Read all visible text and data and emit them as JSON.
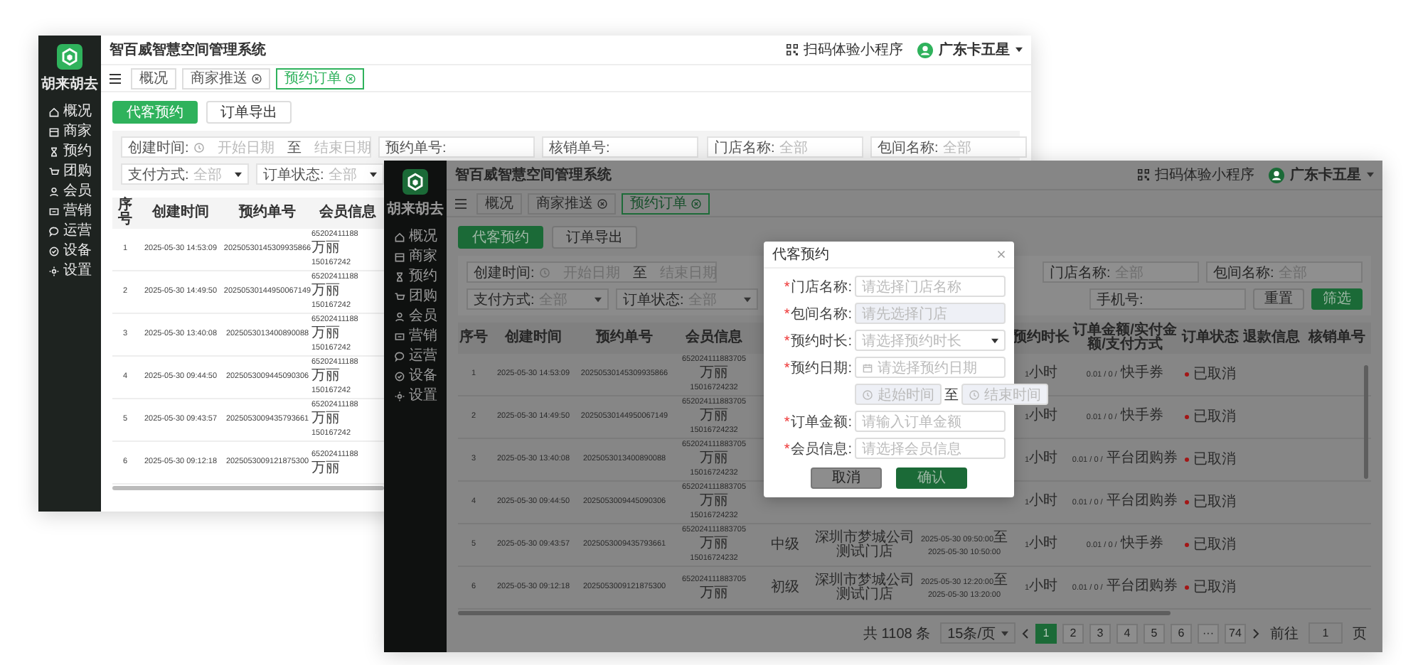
{
  "back_window": {
    "brand": "胡来胡去",
    "title": "智百威智慧空间管理系统",
    "qr_label": "扫码体验小程序",
    "user": "广东卡五星",
    "menu": [
      "概况",
      "商家",
      "预约",
      "团购",
      "会员",
      "营销",
      "运营",
      "设备",
      "设置"
    ],
    "tabs": [
      {
        "label": "概况",
        "closable": false,
        "selected": false
      },
      {
        "label": "商家推送",
        "closable": true,
        "selected": false
      },
      {
        "label": "预约订单",
        "closable": true,
        "selected": true
      }
    ],
    "actions": [
      {
        "label": "代客预约",
        "primary": true
      },
      {
        "label": "订单导出",
        "primary": false
      }
    ],
    "filters": [
      {
        "left": [
          {
            "kind": "range",
            "label": "创建时间:",
            "start": "开始日期",
            "sep": "至",
            "end": "结束日期"
          },
          {
            "kind": "text",
            "label": "预约单号:"
          },
          {
            "kind": "text",
            "label": "核销单号:"
          }
        ],
        "right": [
          {
            "kind": "text",
            "label": "门店名称:",
            "placeholder": "全部"
          },
          {
            "kind": "text",
            "label": "包间名称:",
            "placeholder": "全部"
          }
        ]
      },
      {
        "left": [
          {
            "kind": "select",
            "label": "支付方式:",
            "placeholder": "全部"
          },
          {
            "kind": "select",
            "label": "订单状态:",
            "placeholder": "全部"
          }
        ]
      }
    ],
    "table": {
      "columns": [
        "序号",
        "创建时间",
        "预约单号",
        "会员信息"
      ],
      "rows": [
        {
          "no": "1",
          "created": "2025-05-30 14:53:09",
          "order_no": "20250530145309935866",
          "member": [
            "65202411188",
            "万丽",
            "150167242"
          ]
        },
        {
          "no": "2",
          "created": "2025-05-30 14:49:50",
          "order_no": "20250530144950067149",
          "member": [
            "65202411188",
            "万丽",
            "150167242"
          ]
        },
        {
          "no": "3",
          "created": "2025-05-30 13:40:08",
          "order_no": "2025053013400890088",
          "member": [
            "65202411188",
            "万丽",
            "150167242"
          ]
        },
        {
          "no": "4",
          "created": "2025-05-30 09:44:50",
          "order_no": "2025053009445090306",
          "member": [
            "65202411188",
            "万丽",
            "150167242"
          ]
        },
        {
          "no": "5",
          "created": "2025-05-30 09:43:57",
          "order_no": "2025053009435793661",
          "member": [
            "65202411188",
            "万丽",
            "150167242"
          ]
        },
        {
          "no": "6",
          "created": "2025-05-30 09:12:18",
          "order_no": "2025053009121875300",
          "member": [
            "65202411188",
            "万丽"
          ]
        }
      ]
    }
  },
  "front_window": {
    "brand": "胡来胡去",
    "title": "智百威智慧空间管理系统",
    "qr_label": "扫码体验小程序",
    "user": "广东卡五星",
    "menu": [
      "概况",
      "商家",
      "预约",
      "团购",
      "会员",
      "营销",
      "运营",
      "设备",
      "设置"
    ],
    "tabs": [
      {
        "label": "概况",
        "closable": false,
        "selected": false
      },
      {
        "label": "商家推送",
        "closable": true,
        "selected": false
      },
      {
        "label": "预约订单",
        "closable": true,
        "selected": true
      }
    ],
    "actions": [
      {
        "label": "代客预约",
        "primary": true
      },
      {
        "label": "订单导出",
        "primary": false
      }
    ],
    "filters": [
      {
        "left": [
          {
            "kind": "range",
            "label": "创建时间:",
            "start": "开始日期",
            "sep": "至",
            "end": "结束日期"
          }
        ],
        "right": [
          {
            "kind": "text",
            "label": "门店名称:",
            "placeholder": "全部"
          },
          {
            "kind": "text",
            "label": "包间名称:",
            "placeholder": "全部"
          }
        ]
      },
      {
        "left": [
          {
            "kind": "select",
            "label": "支付方式:",
            "placeholder": "全部"
          },
          {
            "kind": "select",
            "label": "订单状态:",
            "placeholder": "全部"
          }
        ],
        "right": [
          {
            "kind": "text",
            "label": "手机号:"
          },
          {
            "kind": "button",
            "label": "重置",
            "primary": false
          },
          {
            "kind": "button",
            "label": "筛选",
            "primary": true
          }
        ]
      }
    ],
    "table": {
      "columns": [
        "序号",
        "创建时间",
        "预约单号",
        "会员信息",
        "预约时长",
        "订单金额/实付金额/支付方式",
        "订单状态",
        "退款信息",
        "核销单号"
      ],
      "rows": [
        {
          "no": "1",
          "created": "2025-05-30 14:53:09",
          "order_no": "20250530145309935866",
          "member": [
            "652024111883705",
            "万丽",
            "15016724232"
          ],
          "duration": "1小时",
          "amount": "0.01 / 0 / 快手券",
          "status": "已取消",
          "color": "#a31616"
        },
        {
          "no": "2",
          "created": "2025-05-30 14:49:50",
          "order_no": "20250530144950067149",
          "member": [
            "652024111883705",
            "万丽",
            "15016724232"
          ],
          "duration": "1小时",
          "amount": "0.01 / 0 / 快手券",
          "status": "已取消",
          "color": "#a31616"
        },
        {
          "no": "3",
          "created": "2025-05-30 13:40:08",
          "order_no": "2025053013400890088",
          "member": [
            "652024111883705",
            "万丽",
            "15016724232"
          ],
          "duration": "1小时",
          "amount": "0.01 / 0 / 平台团购券",
          "status": "已取消",
          "color": "#a31616"
        },
        {
          "no": "4",
          "created": "2025-05-30 09:44:50",
          "order_no": "2025053009445090306",
          "member": [
            "652024111883705",
            "万丽",
            "15016724232"
          ],
          "duration": "1小时",
          "amount": "0.01 / 0 / 平台团购券",
          "status": "已取消",
          "color": "#a31616"
        },
        {
          "no": "5",
          "created": "2025-05-30 09:43:57",
          "order_no": "2025053009435793661",
          "member": [
            "652024111883705",
            "万丽",
            "15016724232"
          ],
          "level": "中级",
          "store": [
            "深圳市梦城公司",
            "测试门店"
          ],
          "slot": [
            "2025-05-30 09:50:00至",
            "2025-05-30 10:50:00"
          ],
          "duration": "1小时",
          "amount": "0.01 / 0 / 快手券",
          "status": "已取消",
          "color": "#a31616"
        },
        {
          "no": "6",
          "created": "2025-05-30 09:12:18",
          "order_no": "2025053009121875300",
          "member": [
            "652024111883705",
            "万丽"
          ],
          "level": "初级",
          "store": [
            "深圳市梦城公司",
            "测试门店"
          ],
          "slot": [
            "2025-05-30 12:20:00至",
            "2025-05-30 13:20:00"
          ],
          "duration": "1小时",
          "amount": "0.01 / 0 / 平台团购券",
          "status": "已取消",
          "color": "#a31616"
        }
      ]
    },
    "pagination": {
      "total": "共 1108 条",
      "page_size": "15条/页",
      "pages": [
        {
          "label": "1",
          "selected": true
        },
        {
          "label": "2",
          "selected": false
        },
        {
          "label": "3",
          "selected": false
        },
        {
          "label": "4",
          "selected": false
        },
        {
          "label": "5",
          "selected": false
        },
        {
          "label": "6",
          "selected": false
        },
        {
          "label": "···",
          "selected": false
        },
        {
          "label": "74",
          "selected": false
        }
      ],
      "goto_label": "前往",
      "goto_value": "1",
      "goto_suffix": "页"
    },
    "dialog": {
      "title": "代客预约",
      "fields": [
        {
          "kind": "text",
          "mark": "*",
          "label": "门店名称:",
          "placeholder": "请选择门店名称",
          "disabled": false
        },
        {
          "kind": "text",
          "mark": "*",
          "label": "包间名称:",
          "placeholder": "请先选择门店",
          "disabled": true
        },
        {
          "kind": "select",
          "mark": "*",
          "label": "预约时长:",
          "placeholder": "请选择预约时长",
          "disabled": false
        },
        {
          "kind": "date",
          "mark": "*",
          "label": "预约日期:",
          "placeholder": "请选择预约日期",
          "disabled": false
        },
        {
          "kind": "time_range",
          "start": "起始时间",
          "sep": "至",
          "end": "结束时间",
          "disabled": true
        },
        {
          "kind": "text",
          "mark": "*",
          "label": "订单金额:",
          "placeholder": "请输入订单金额",
          "disabled": false
        },
        {
          "kind": "text",
          "mark": "*",
          "label": "会员信息:",
          "placeholder": "请选择会员信息",
          "disabled": false
        }
      ],
      "buttons": [
        {
          "label": "取消",
          "primary": false
        },
        {
          "label": "确认",
          "primary": true
        }
      ]
    }
  }
}
